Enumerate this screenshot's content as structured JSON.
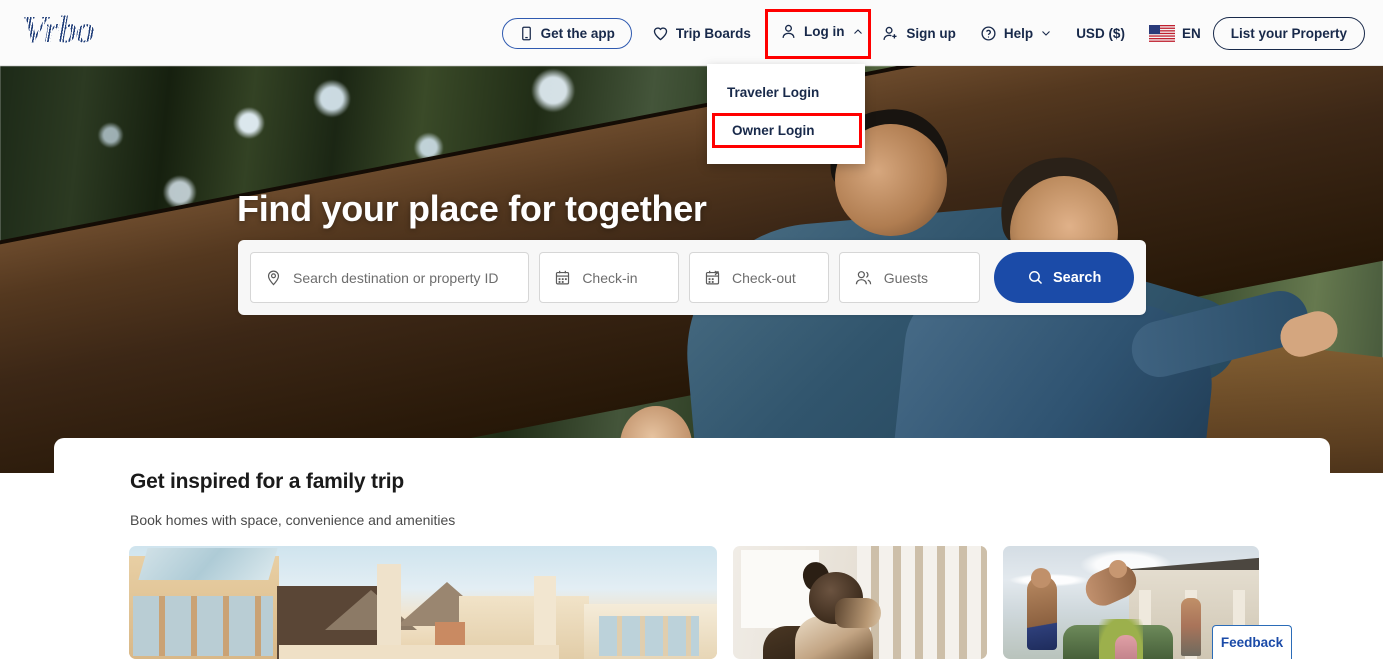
{
  "header": {
    "logo_text": "Vrbo",
    "nav": {
      "get_the_app": "Get the app",
      "trip_boards": "Trip Boards",
      "log_in": "Log in",
      "sign_up": "Sign up",
      "help": "Help",
      "currency": "USD ($)",
      "language": "EN",
      "list_your_property": "List your Property"
    },
    "login_dropdown": {
      "traveler_login": "Traveler Login",
      "owner_login": "Owner Login"
    }
  },
  "hero": {
    "title": "Find your place for together"
  },
  "search": {
    "destination_placeholder": "Search destination or property ID",
    "checkin_placeholder": "Check-in",
    "checkout_placeholder": "Check-out",
    "guests_placeholder": "Guests",
    "search_button": "Search"
  },
  "content": {
    "section_title": "Get inspired for a family trip",
    "section_subtitle": "Book homes with space, convenience and amenities"
  },
  "feedback": {
    "label": "Feedback"
  },
  "colors": {
    "brand_blue": "#1b4ba8",
    "nav_text": "#18294a",
    "highlight_red": "#ff0000",
    "header_bg": "#fbfbfb"
  },
  "icons": {
    "phone": "phone-icon",
    "heart": "heart-icon",
    "user": "user-icon",
    "user_plus": "user-plus-icon",
    "question": "question-circle-icon",
    "chevron_up": "chevron-up-icon",
    "chevron_down": "chevron-down-icon",
    "flag": "us-flag-icon",
    "pin": "location-pin-icon",
    "calendar": "calendar-icon",
    "guests": "guests-icon",
    "search": "search-icon"
  }
}
